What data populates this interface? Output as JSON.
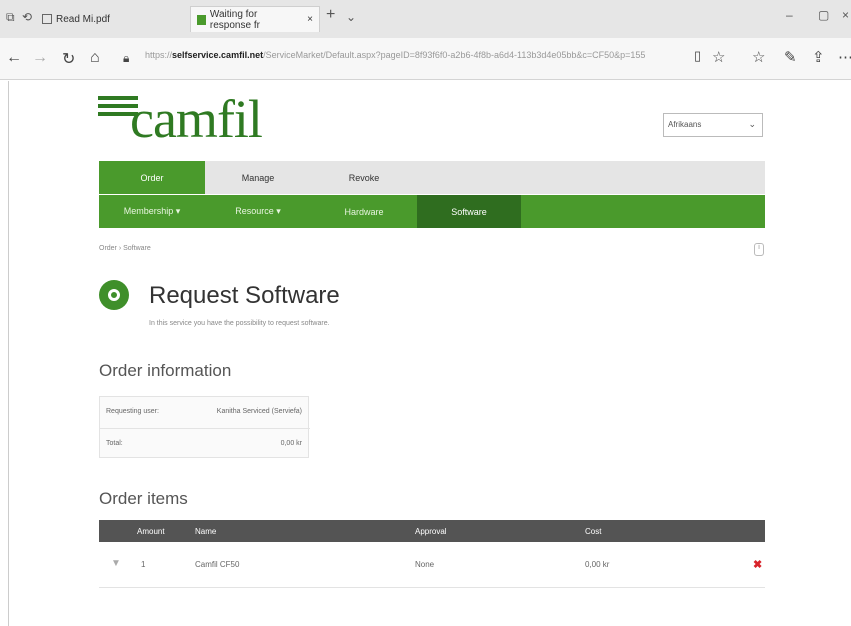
{
  "browser": {
    "tabs": [
      {
        "label": "Read Mi.pdf",
        "active": false
      },
      {
        "label": "Waiting for response fr",
        "active": true
      }
    ],
    "url_host": "selfservice.camfil.net",
    "url_scheme": "https://",
    "url_rest": "/ServiceMarket/Default.aspx?pageID=8f93f6f0-a2b6-4f8b-a6d4-113b3d4e05bb&c=CF50&p=155"
  },
  "header": {
    "logo_text": "camfil",
    "language_value": "Afrikaans"
  },
  "menu_main": [
    "Order",
    "Manage",
    "Revoke"
  ],
  "menu_sub": [
    "Membership ▾",
    "Resource ▾",
    "Hardware",
    "Software"
  ],
  "breadcrumb": "Order › Software",
  "page": {
    "title": "Request Software",
    "subtitle": "In this service you have the possibility to request software."
  },
  "order_info": {
    "heading": "Order information",
    "rows": [
      {
        "label": "Requesting user:",
        "value": "Kanitha Serviced (Serviefa)"
      },
      {
        "label": "Total:",
        "value": "0,00 kr"
      }
    ]
  },
  "order_items": {
    "heading": "Order items",
    "columns": [
      "Amount",
      "Name",
      "Approval",
      "Cost"
    ],
    "rows": [
      {
        "amount": "1",
        "name": "Camfil CF50",
        "approval": "None",
        "cost": "0,00 kr"
      }
    ]
  },
  "colors": {
    "brand_green": "#4a9a2c",
    "dark_green": "#2f6d1f",
    "delete_red": "#d8232a"
  }
}
